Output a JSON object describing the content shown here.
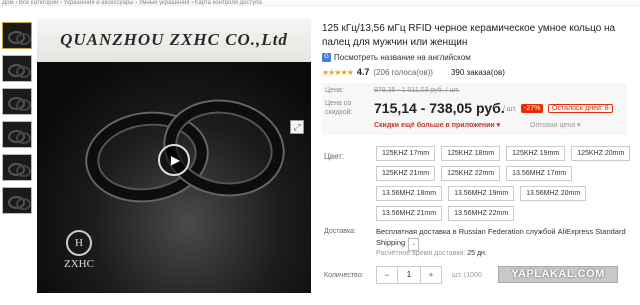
{
  "breadcrumb": "Дом › Все категории › Украшения и аксессуары › Умные украшения › Карта контроля доступа",
  "product": {
    "title": "125 кГц/13,56 мГц RFID черное керамическое умное кольцо на палец для мужчин или женщин",
    "translate_link": "Посмотреть название на английском",
    "rating_score": "4.7",
    "votes": "(206 голоса(ов))",
    "orders": "390 заказа(ов)"
  },
  "image": {
    "banner_text": "QUANZHOU ZXHC CO.,Ltd",
    "brand_emblem": "H",
    "brand_name": "ZXHC",
    "play_icon": "▶",
    "zoom_icon": "⤢"
  },
  "price": {
    "price_label": "Цена:",
    "old_price": "979,35 - 1 011,03 руб. / шт.",
    "sale_label": "Цена со скидкой:",
    "new_price": "715,14 - 738,05 руб.",
    "unit": "/ шт.",
    "discount": "-27%",
    "remaining": "Осталось дней: 8",
    "app_discount": "Скидки ещё больше в приложении ▾",
    "wholesale": "Оптовая цена ▾"
  },
  "colors": {
    "label": "Цвет:",
    "options": [
      "125KHZ 17mm",
      "125KHZ 18mm",
      "125KHZ 19mm",
      "125KHZ 20mm",
      "125KHZ 21mm",
      "125KHZ 22mm",
      "13.56MHZ 17mm",
      "13.56MHZ 18mm",
      "13.56MHZ 19mm",
      "13.56MHZ 20mm",
      "13.56MHZ 21mm",
      "13.56MHZ 22mm"
    ]
  },
  "shipping": {
    "label": "Доставка:",
    "text": "Бесплатная доставка в Russian Federation службой AliExpress Standard Shipping",
    "chevron": "⌄",
    "time_label": "Расчётное время доставки:",
    "time_value": "25 дн."
  },
  "quantity": {
    "label": "Количество:",
    "minus": "−",
    "value": "1",
    "plus": "+",
    "available": "шт. (1000"
  },
  "watermark": "YAPLAKAL.COM",
  "accent_color": "#e62e04"
}
